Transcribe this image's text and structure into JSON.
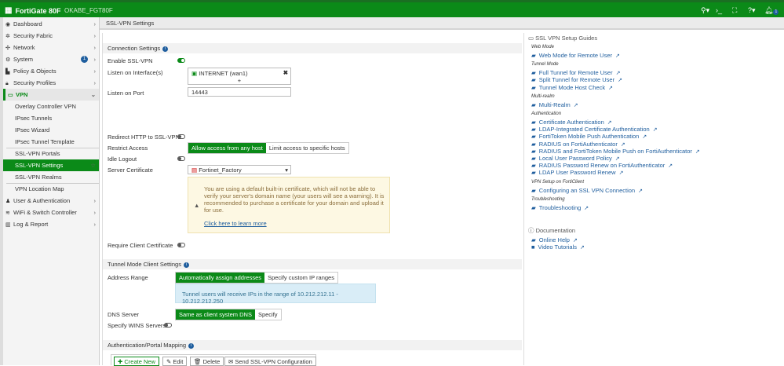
{
  "header": {
    "product": "FortiGate 80F",
    "hostname": "OKABE_FGT80F",
    "notification_count": "1"
  },
  "sidebar": {
    "items": [
      {
        "label": "Dashboard",
        "icon": "dashboard-icon"
      },
      {
        "label": "Security Fabric",
        "icon": "fabric-icon"
      },
      {
        "label": "Network",
        "icon": "network-icon"
      },
      {
        "label": "System",
        "icon": "gear-icon",
        "badge": "1"
      },
      {
        "label": "Policy & Objects",
        "icon": "policy-icon"
      },
      {
        "label": "Security Profiles",
        "icon": "lock-icon"
      },
      {
        "label": "VPN",
        "icon": "laptop-icon"
      },
      {
        "label": "Overlay Controller VPN"
      },
      {
        "label": "IPsec Tunnels"
      },
      {
        "label": "IPsec Wizard"
      },
      {
        "label": "IPsec Tunnel Template"
      },
      {
        "label": "SSL-VPN Portals"
      },
      {
        "label": "SSL-VPN Settings"
      },
      {
        "label": "SSL-VPN Realms"
      },
      {
        "label": "VPN Location Map"
      },
      {
        "label": "User & Authentication",
        "icon": "user-icon"
      },
      {
        "label": "WiFi & Switch Controller",
        "icon": "wifi-icon"
      },
      {
        "label": "Log & Report",
        "icon": "chart-icon"
      }
    ]
  },
  "breadcrumb": "SSL-VPN Settings",
  "connection": {
    "title": "Connection Settings",
    "enable_label": "Enable SSL-VPN",
    "listen_iface_label": "Listen on Interface(s)",
    "listen_iface_value": "INTERNET (wan1)",
    "listen_port_label": "Listen on Port",
    "listen_port_value": "14443",
    "redirect_label": "Redirect HTTP to SSL-VPN",
    "restrict_label": "Restrict Access",
    "restrict_opt1": "Allow access from any host",
    "restrict_opt2": "Limit access to specific hosts",
    "idle_label": "Idle Logout",
    "cert_label": "Server Certificate",
    "cert_value": "Fortinet_Factory",
    "warning_text": "You are using a default built-in certificate, which will not be able to verify your server's domain name (your users will see a warning). It is recommended to purchase a certificate for your domain and upload it for use.",
    "warning_link": "Click here to learn more",
    "require_cert_label": "Require Client Certificate"
  },
  "tunnel": {
    "title": "Tunnel Mode Client Settings",
    "address_label": "Address Range",
    "address_opt1": "Automatically assign addresses",
    "address_opt2": "Specify custom IP ranges",
    "address_info": "Tunnel users will receive IPs in the range of 10.212.212.11 - 10.212.212.250",
    "dns_label": "DNS Server",
    "dns_opt1": "Same as client system DNS",
    "dns_opt2": "Specify",
    "wins_label": "Specify WINS Servers"
  },
  "mapping": {
    "title": "Authentication/Portal Mapping",
    "create": "Create New",
    "edit": "Edit",
    "delete": "Delete",
    "send": "Send SSL-VPN Configuration"
  },
  "guides": {
    "title": "SSL VPN Setup Guides",
    "cat_web": "Web Mode",
    "web": [
      "Web Mode for Remote User"
    ],
    "cat_tunnel": "Tunnel Mode",
    "tunnel": [
      "Full Tunnel for Remote User",
      "Split Tunnel for Remote User",
      "Tunnel Mode Host Check"
    ],
    "cat_realm": "Multi-realm",
    "realm": [
      "Multi-Realm"
    ],
    "cat_auth": "Authentication",
    "auth": [
      "Certificate Authentication",
      "LDAP-Integrated Certificate Authentication",
      "FortiToken Mobile Push Authentication",
      "RADIUS on FortiAuthenticator",
      "RADIUS and FortiToken Mobile Push on FortiAuthenticator",
      "Local User Password Policy",
      "RADIUS Password Renew on FortiAuthenticator",
      "LDAP User Password Renew"
    ],
    "cat_forticlient": "VPN Setup on FortiClient",
    "forticlient": [
      "Configuring an SSL VPN Connection"
    ],
    "cat_trouble": "Troubleshooting",
    "trouble": [
      "Troubleshooting"
    ]
  },
  "documentation": {
    "title": "Documentation",
    "links": [
      "Online Help",
      "Video Tutorials"
    ]
  }
}
